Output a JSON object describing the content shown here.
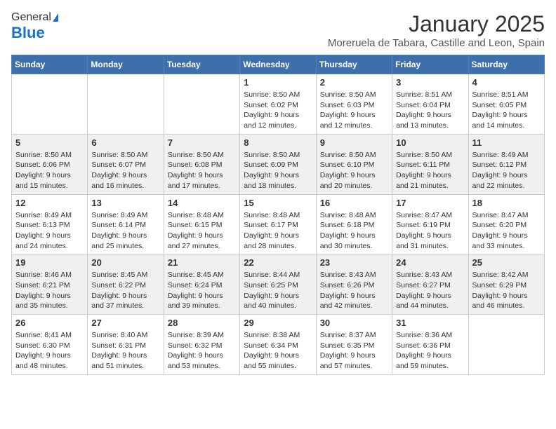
{
  "header": {
    "logo_general": "General",
    "logo_blue": "Blue",
    "month_title": "January 2025",
    "location": "Moreruela de Tabara, Castille and Leon, Spain"
  },
  "weekdays": [
    "Sunday",
    "Monday",
    "Tuesday",
    "Wednesday",
    "Thursday",
    "Friday",
    "Saturday"
  ],
  "weeks": [
    [
      {
        "day": "",
        "sunrise": "",
        "sunset": "",
        "daylight": ""
      },
      {
        "day": "",
        "sunrise": "",
        "sunset": "",
        "daylight": ""
      },
      {
        "day": "",
        "sunrise": "",
        "sunset": "",
        "daylight": ""
      },
      {
        "day": "1",
        "sunrise": "Sunrise: 8:50 AM",
        "sunset": "Sunset: 6:02 PM",
        "daylight": "Daylight: 9 hours and 12 minutes."
      },
      {
        "day": "2",
        "sunrise": "Sunrise: 8:50 AM",
        "sunset": "Sunset: 6:03 PM",
        "daylight": "Daylight: 9 hours and 12 minutes."
      },
      {
        "day": "3",
        "sunrise": "Sunrise: 8:51 AM",
        "sunset": "Sunset: 6:04 PM",
        "daylight": "Daylight: 9 hours and 13 minutes."
      },
      {
        "day": "4",
        "sunrise": "Sunrise: 8:51 AM",
        "sunset": "Sunset: 6:05 PM",
        "daylight": "Daylight: 9 hours and 14 minutes."
      }
    ],
    [
      {
        "day": "5",
        "sunrise": "Sunrise: 8:50 AM",
        "sunset": "Sunset: 6:06 PM",
        "daylight": "Daylight: 9 hours and 15 minutes."
      },
      {
        "day": "6",
        "sunrise": "Sunrise: 8:50 AM",
        "sunset": "Sunset: 6:07 PM",
        "daylight": "Daylight: 9 hours and 16 minutes."
      },
      {
        "day": "7",
        "sunrise": "Sunrise: 8:50 AM",
        "sunset": "Sunset: 6:08 PM",
        "daylight": "Daylight: 9 hours and 17 minutes."
      },
      {
        "day": "8",
        "sunrise": "Sunrise: 8:50 AM",
        "sunset": "Sunset: 6:09 PM",
        "daylight": "Daylight: 9 hours and 18 minutes."
      },
      {
        "day": "9",
        "sunrise": "Sunrise: 8:50 AM",
        "sunset": "Sunset: 6:10 PM",
        "daylight": "Daylight: 9 hours and 20 minutes."
      },
      {
        "day": "10",
        "sunrise": "Sunrise: 8:50 AM",
        "sunset": "Sunset: 6:11 PM",
        "daylight": "Daylight: 9 hours and 21 minutes."
      },
      {
        "day": "11",
        "sunrise": "Sunrise: 8:49 AM",
        "sunset": "Sunset: 6:12 PM",
        "daylight": "Daylight: 9 hours and 22 minutes."
      }
    ],
    [
      {
        "day": "12",
        "sunrise": "Sunrise: 8:49 AM",
        "sunset": "Sunset: 6:13 PM",
        "daylight": "Daylight: 9 hours and 24 minutes."
      },
      {
        "day": "13",
        "sunrise": "Sunrise: 8:49 AM",
        "sunset": "Sunset: 6:14 PM",
        "daylight": "Daylight: 9 hours and 25 minutes."
      },
      {
        "day": "14",
        "sunrise": "Sunrise: 8:48 AM",
        "sunset": "Sunset: 6:15 PM",
        "daylight": "Daylight: 9 hours and 27 minutes."
      },
      {
        "day": "15",
        "sunrise": "Sunrise: 8:48 AM",
        "sunset": "Sunset: 6:17 PM",
        "daylight": "Daylight: 9 hours and 28 minutes."
      },
      {
        "day": "16",
        "sunrise": "Sunrise: 8:48 AM",
        "sunset": "Sunset: 6:18 PM",
        "daylight": "Daylight: 9 hours and 30 minutes."
      },
      {
        "day": "17",
        "sunrise": "Sunrise: 8:47 AM",
        "sunset": "Sunset: 6:19 PM",
        "daylight": "Daylight: 9 hours and 31 minutes."
      },
      {
        "day": "18",
        "sunrise": "Sunrise: 8:47 AM",
        "sunset": "Sunset: 6:20 PM",
        "daylight": "Daylight: 9 hours and 33 minutes."
      }
    ],
    [
      {
        "day": "19",
        "sunrise": "Sunrise: 8:46 AM",
        "sunset": "Sunset: 6:21 PM",
        "daylight": "Daylight: 9 hours and 35 minutes."
      },
      {
        "day": "20",
        "sunrise": "Sunrise: 8:45 AM",
        "sunset": "Sunset: 6:22 PM",
        "daylight": "Daylight: 9 hours and 37 minutes."
      },
      {
        "day": "21",
        "sunrise": "Sunrise: 8:45 AM",
        "sunset": "Sunset: 6:24 PM",
        "daylight": "Daylight: 9 hours and 39 minutes."
      },
      {
        "day": "22",
        "sunrise": "Sunrise: 8:44 AM",
        "sunset": "Sunset: 6:25 PM",
        "daylight": "Daylight: 9 hours and 40 minutes."
      },
      {
        "day": "23",
        "sunrise": "Sunrise: 8:43 AM",
        "sunset": "Sunset: 6:26 PM",
        "daylight": "Daylight: 9 hours and 42 minutes."
      },
      {
        "day": "24",
        "sunrise": "Sunrise: 8:43 AM",
        "sunset": "Sunset: 6:27 PM",
        "daylight": "Daylight: 9 hours and 44 minutes."
      },
      {
        "day": "25",
        "sunrise": "Sunrise: 8:42 AM",
        "sunset": "Sunset: 6:29 PM",
        "daylight": "Daylight: 9 hours and 46 minutes."
      }
    ],
    [
      {
        "day": "26",
        "sunrise": "Sunrise: 8:41 AM",
        "sunset": "Sunset: 6:30 PM",
        "daylight": "Daylight: 9 hours and 48 minutes."
      },
      {
        "day": "27",
        "sunrise": "Sunrise: 8:40 AM",
        "sunset": "Sunset: 6:31 PM",
        "daylight": "Daylight: 9 hours and 51 minutes."
      },
      {
        "day": "28",
        "sunrise": "Sunrise: 8:39 AM",
        "sunset": "Sunset: 6:32 PM",
        "daylight": "Daylight: 9 hours and 53 minutes."
      },
      {
        "day": "29",
        "sunrise": "Sunrise: 8:38 AM",
        "sunset": "Sunset: 6:34 PM",
        "daylight": "Daylight: 9 hours and 55 minutes."
      },
      {
        "day": "30",
        "sunrise": "Sunrise: 8:37 AM",
        "sunset": "Sunset: 6:35 PM",
        "daylight": "Daylight: 9 hours and 57 minutes."
      },
      {
        "day": "31",
        "sunrise": "Sunrise: 8:36 AM",
        "sunset": "Sunset: 6:36 PM",
        "daylight": "Daylight: 9 hours and 59 minutes."
      },
      {
        "day": "",
        "sunrise": "",
        "sunset": "",
        "daylight": ""
      }
    ]
  ]
}
